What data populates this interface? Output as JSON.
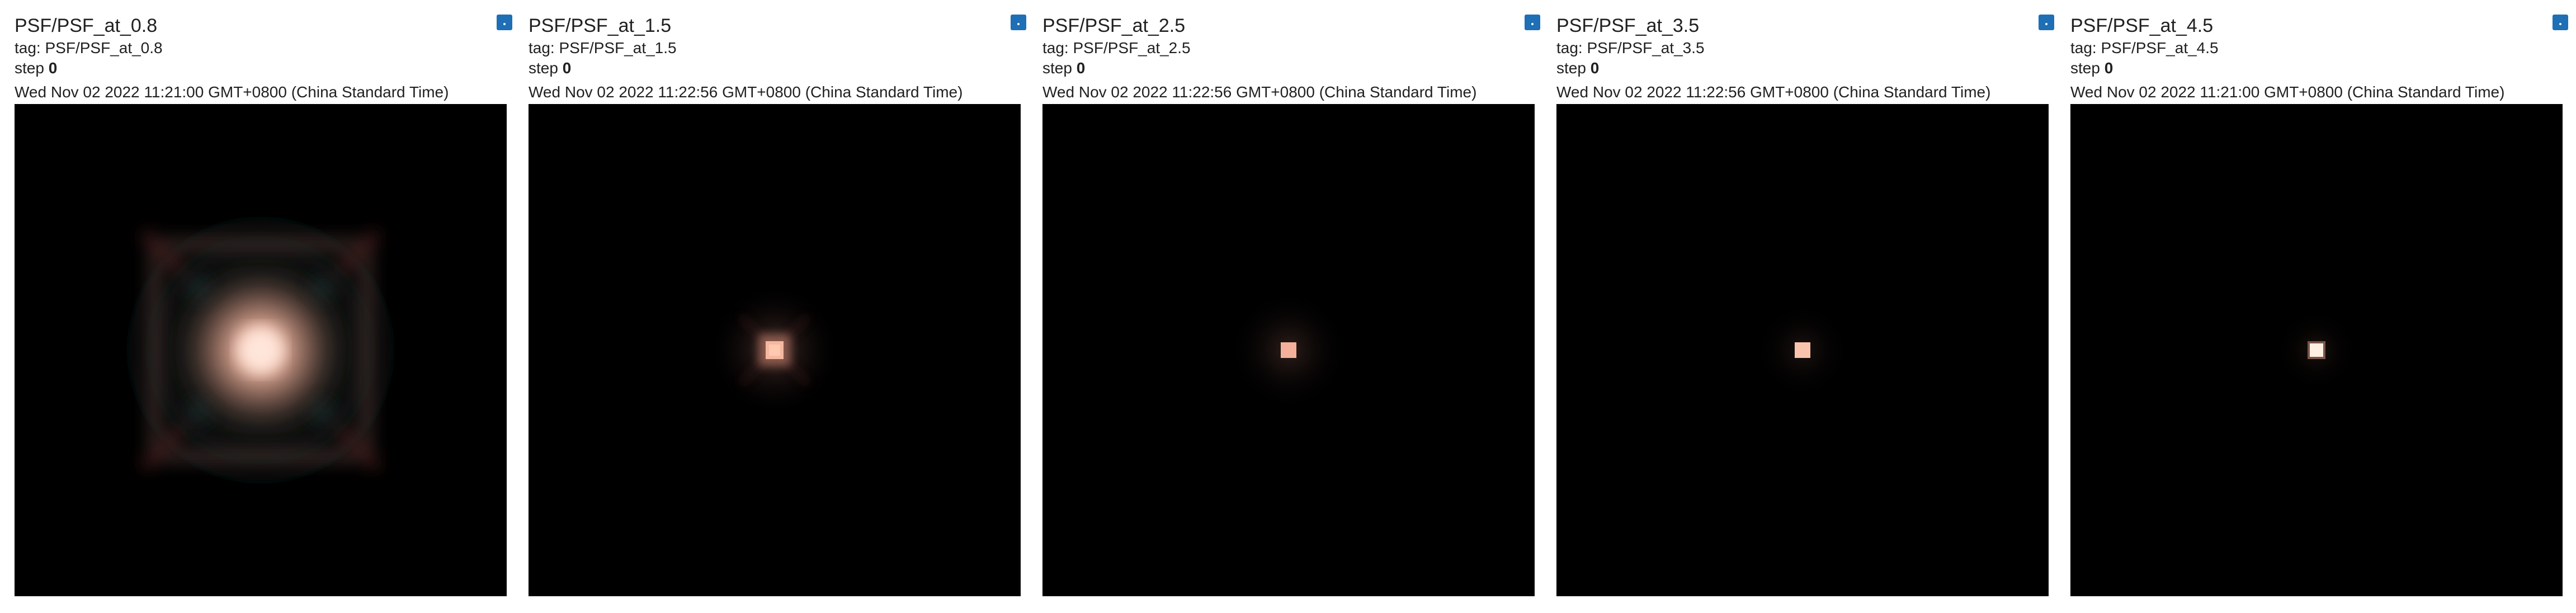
{
  "cards": [
    {
      "title": "PSF/PSF_at_0.8",
      "tag_prefix": "tag: ",
      "tag": "PSF/PSF_at_0.8",
      "step_label": "step",
      "step": "0",
      "timestamp": "Wed Nov 02 2022 11:21:00 GMT+0800 (China Standard Time)",
      "menu_icon": "expand-icon"
    },
    {
      "title": "PSF/PSF_at_1.5",
      "tag_prefix": "tag: ",
      "tag": "PSF/PSF_at_1.5",
      "step_label": "step",
      "step": "0",
      "timestamp": "Wed Nov 02 2022 11:22:56 GMT+0800 (China Standard Time)",
      "menu_icon": "expand-icon"
    },
    {
      "title": "PSF/PSF_at_2.5",
      "tag_prefix": "tag: ",
      "tag": "PSF/PSF_at_2.5",
      "step_label": "step",
      "step": "0",
      "timestamp": "Wed Nov 02 2022 11:22:56 GMT+0800 (China Standard Time)",
      "menu_icon": "expand-icon"
    },
    {
      "title": "PSF/PSF_at_3.5",
      "tag_prefix": "tag: ",
      "tag": "PSF/PSF_at_3.5",
      "step_label": "step",
      "step": "0",
      "timestamp": "Wed Nov 02 2022 11:22:56 GMT+0800 (China Standard Time)",
      "menu_icon": "expand-icon"
    },
    {
      "title": "PSF/PSF_at_4.5",
      "tag_prefix": "tag: ",
      "tag": "PSF/PSF_at_4.5",
      "step_label": "step",
      "step": "0",
      "timestamp": "Wed Nov 02 2022 11:21:00 GMT+0800 (China Standard Time)",
      "menu_icon": "expand-icon"
    }
  ],
  "colors": {
    "accent": "#1e6fb5",
    "image_background": "#000000",
    "text": "#212121"
  }
}
